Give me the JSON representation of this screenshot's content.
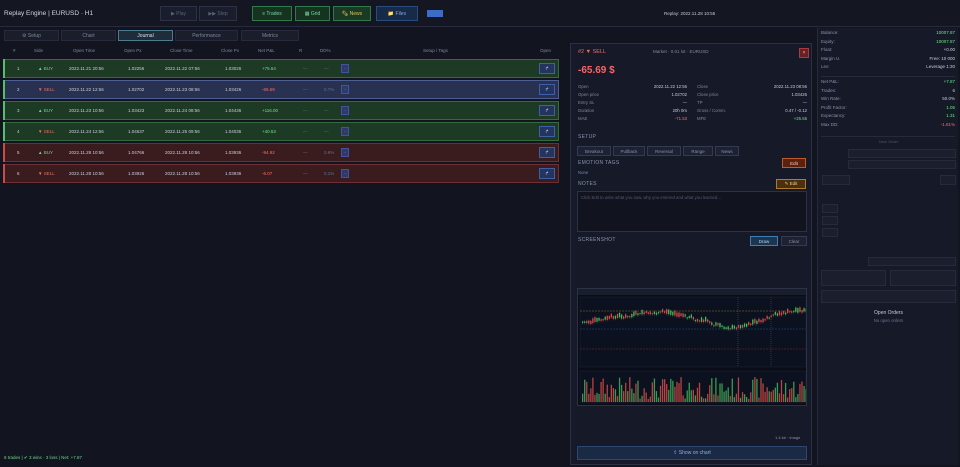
{
  "app": {
    "title": "Replay Engine  |  EURUSD · H1"
  },
  "toolbar": {
    "disabled_1": "▶ Play",
    "disabled_2": "▶▶ Step",
    "trades": "≡ Trades",
    "grid": "▦ Grid",
    "news": "🗞 News",
    "files": "📁 Files",
    "replay_time": "Replay: 2022.11.28 10:55"
  },
  "tabs": [
    {
      "label": "⚙ Setup"
    },
    {
      "label": "Chart"
    },
    {
      "label": "Journal"
    },
    {
      "label": "Performance"
    },
    {
      "label": "Metrics"
    }
  ],
  "table": {
    "headers": [
      "#",
      "Side",
      "Open Time",
      "Open Px",
      "Close Time",
      "Close Px",
      "Net P&L",
      "R",
      "DD%",
      "Setup / Tags",
      "Open"
    ],
    "rows": [
      {
        "num": "1",
        "side": "▲ BUY",
        "side_type": "buy",
        "open_time": "2022.11.21 20:56",
        "open_px": "1.02256",
        "close_time": "2022.11.22 07:56",
        "close_px": "1.03026",
        "pnl": "+75.64",
        "pnl_type": "pos",
        "r": "—",
        "dd": "—",
        "state": "win",
        "btn": "↱"
      },
      {
        "num": "2",
        "side": "▼ SELL",
        "side_type": "sell",
        "open_time": "2022.11.22 12:56",
        "open_px": "1.02702",
        "close_time": "2022.11.23 08:56",
        "close_px": "1.03426",
        "pnl": "-65.69",
        "pnl_type": "neg",
        "r": "—",
        "dd": "0.7%",
        "state": "selected",
        "btn": "↱"
      },
      {
        "num": "3",
        "side": "▲ BUY",
        "side_type": "buy",
        "open_time": "2022.11.23 10:56",
        "open_px": "1.03423",
        "close_time": "2022.11.24 08:56",
        "close_px": "1.04436",
        "pnl": "+116.00",
        "pnl_type": "pos",
        "r": "—",
        "dd": "—",
        "state": "win",
        "btn": "↱"
      },
      {
        "num": "4",
        "side": "▼ SELL",
        "side_type": "sell",
        "open_time": "2022.11.24 12:56",
        "open_px": "1.04637",
        "close_time": "2022.11.25 09:56",
        "close_px": "1.04036",
        "pnl": "+40.53",
        "pnl_type": "pos",
        "r": "—",
        "dd": "—",
        "state": "win",
        "btn": "↱"
      },
      {
        "num": "5",
        "side": "▲ BUY",
        "side_type": "buy",
        "open_time": "2022.11.28 10:56",
        "open_px": "1.04766",
        "close_time": "2022.11.28 10:56",
        "close_px": "1.03936",
        "pnl": "-94.92",
        "pnl_type": "neg",
        "r": "—",
        "dd": "0.9%",
        "state": "loss",
        "btn": "↱"
      },
      {
        "num": "6",
        "side": "▼ SELL",
        "side_type": "sell",
        "open_time": "2022.11.28 10:56",
        "open_px": "1.03926",
        "close_time": "2022.11.28 10:56",
        "close_px": "1.03936",
        "pnl": "-6.07",
        "pnl_type": "neg",
        "r": "—",
        "dd": "0.1%",
        "state": "loss",
        "btn": "↱"
      }
    ]
  },
  "status": {
    "text": "6 trades  |  ✔ 3 wins · 3 loss  |  Net: +7.87"
  },
  "detail": {
    "side": "#2 ▼ SELL",
    "market": "Market · 0.01 lot · EURUSD",
    "close": "×",
    "pnl": "-65.69 $",
    "fields_left": [
      {
        "k": "Open",
        "v": "2022.11.22 12:56"
      },
      {
        "k": "Open price",
        "v": "1.02702"
      },
      {
        "k": "Entry SL",
        "v": "—"
      },
      {
        "k": "Duration",
        "v": "20h 0m"
      },
      {
        "k": "MAE",
        "v": "-71.53"
      }
    ],
    "fields_right": [
      {
        "k": "Close",
        "v": "2022.11.23 08:56"
      },
      {
        "k": "Close price",
        "v": "1.03426"
      },
      {
        "k": "TP",
        "v": "—"
      },
      {
        "k": "Gross / Comm.",
        "v": "0.47 / -0.12"
      },
      {
        "k": "MFE",
        "v": "+25.55"
      }
    ],
    "setup_label": "SETUP",
    "setup_options": [
      "Breakout",
      "Pullback",
      "Reversal",
      "Range",
      "News"
    ],
    "tags_label": "EMOTION TAGS",
    "tags_value": "None",
    "edit_tags": "Edit",
    "notes_label": "NOTES",
    "edit_notes": "✎ Edit",
    "notes_placeholder": "Click Edit to write what you saw, why you entered and what you learned…",
    "screenshot_label": "SCREENSHOT",
    "draw": "Draw",
    "clear": "Clear",
    "shot_size": "1.4 kb · image",
    "show_chart": "⇧ Show on chart"
  },
  "account": {
    "rows": [
      {
        "k": "Balance:",
        "v": "10007.87",
        "type": "green"
      },
      {
        "k": "Equity:",
        "v": "10007.87",
        "type": "green"
      },
      {
        "k": "Float:",
        "v": "+0.00",
        "type": ""
      },
      {
        "k": "Margin U.",
        "v": "Free: 10 000",
        "type": ""
      },
      {
        "k": "Lev:",
        "v": "Leverage 1:30",
        "type": ""
      }
    ],
    "stats": [
      {
        "k": "Net P&L:",
        "v": "+7.87",
        "type": "green"
      },
      {
        "k": "Trades:",
        "v": "6",
        "type": ""
      },
      {
        "k": "Win Rate:",
        "v": "50.0%",
        "type": ""
      },
      {
        "k": "Profit Factor:",
        "v": "1.05",
        "type": "green"
      },
      {
        "k": "Expectancy:",
        "v": "1.31",
        "type": "green"
      },
      {
        "k": "Max DD:",
        "v": "-1.81%",
        "type": "red"
      }
    ],
    "new_order": "New Order",
    "open_orders_title": "Open Orders",
    "open_orders_empty": "No open orders"
  },
  "colors": {
    "win": "#1d3a24",
    "loss": "#3a1c1f",
    "selected": "#283250",
    "accent": "#4d7a90"
  }
}
